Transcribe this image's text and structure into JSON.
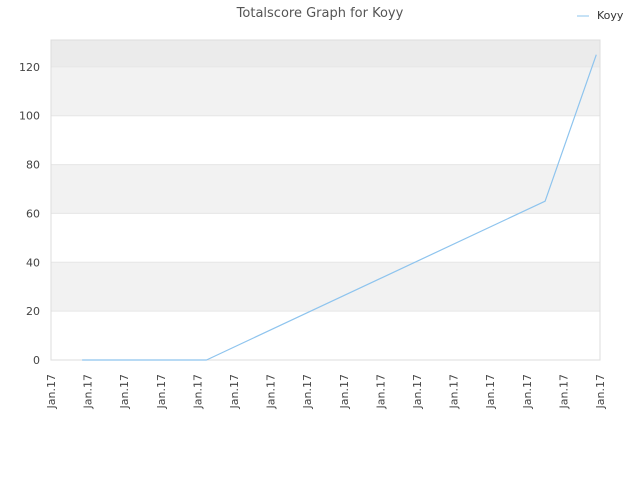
{
  "chart_data": {
    "type": "line",
    "title": "Totalscore Graph for Koyy",
    "xlabel": "",
    "ylabel": "",
    "ylim": [
      0,
      131
    ],
    "y_ticks": [
      0,
      20,
      40,
      60,
      80,
      100,
      120
    ],
    "x_tick_labels": [
      "Jan.17",
      "Jan.17",
      "Jan.17",
      "Jan.17",
      "Jan.17",
      "Jan.17",
      "Jan.17",
      "Jan.17",
      "Jan.17",
      "Jan.17",
      "Jan.17",
      "Jan.17",
      "Jan.17",
      "Jan.17",
      "Jan.17",
      "Jan.17"
    ],
    "grid": true,
    "legend_position": "top-right",
    "colors": {
      "series": "#8ec4ee",
      "band": "#f2f2f2",
      "band_top": "#ebebeb",
      "axis": "#dddddd"
    },
    "series": [
      {
        "name": "Koyy",
        "x": [
          0.85,
          4.25,
          13.5,
          14.9
        ],
        "values": [
          0,
          0,
          65,
          125
        ]
      }
    ]
  }
}
